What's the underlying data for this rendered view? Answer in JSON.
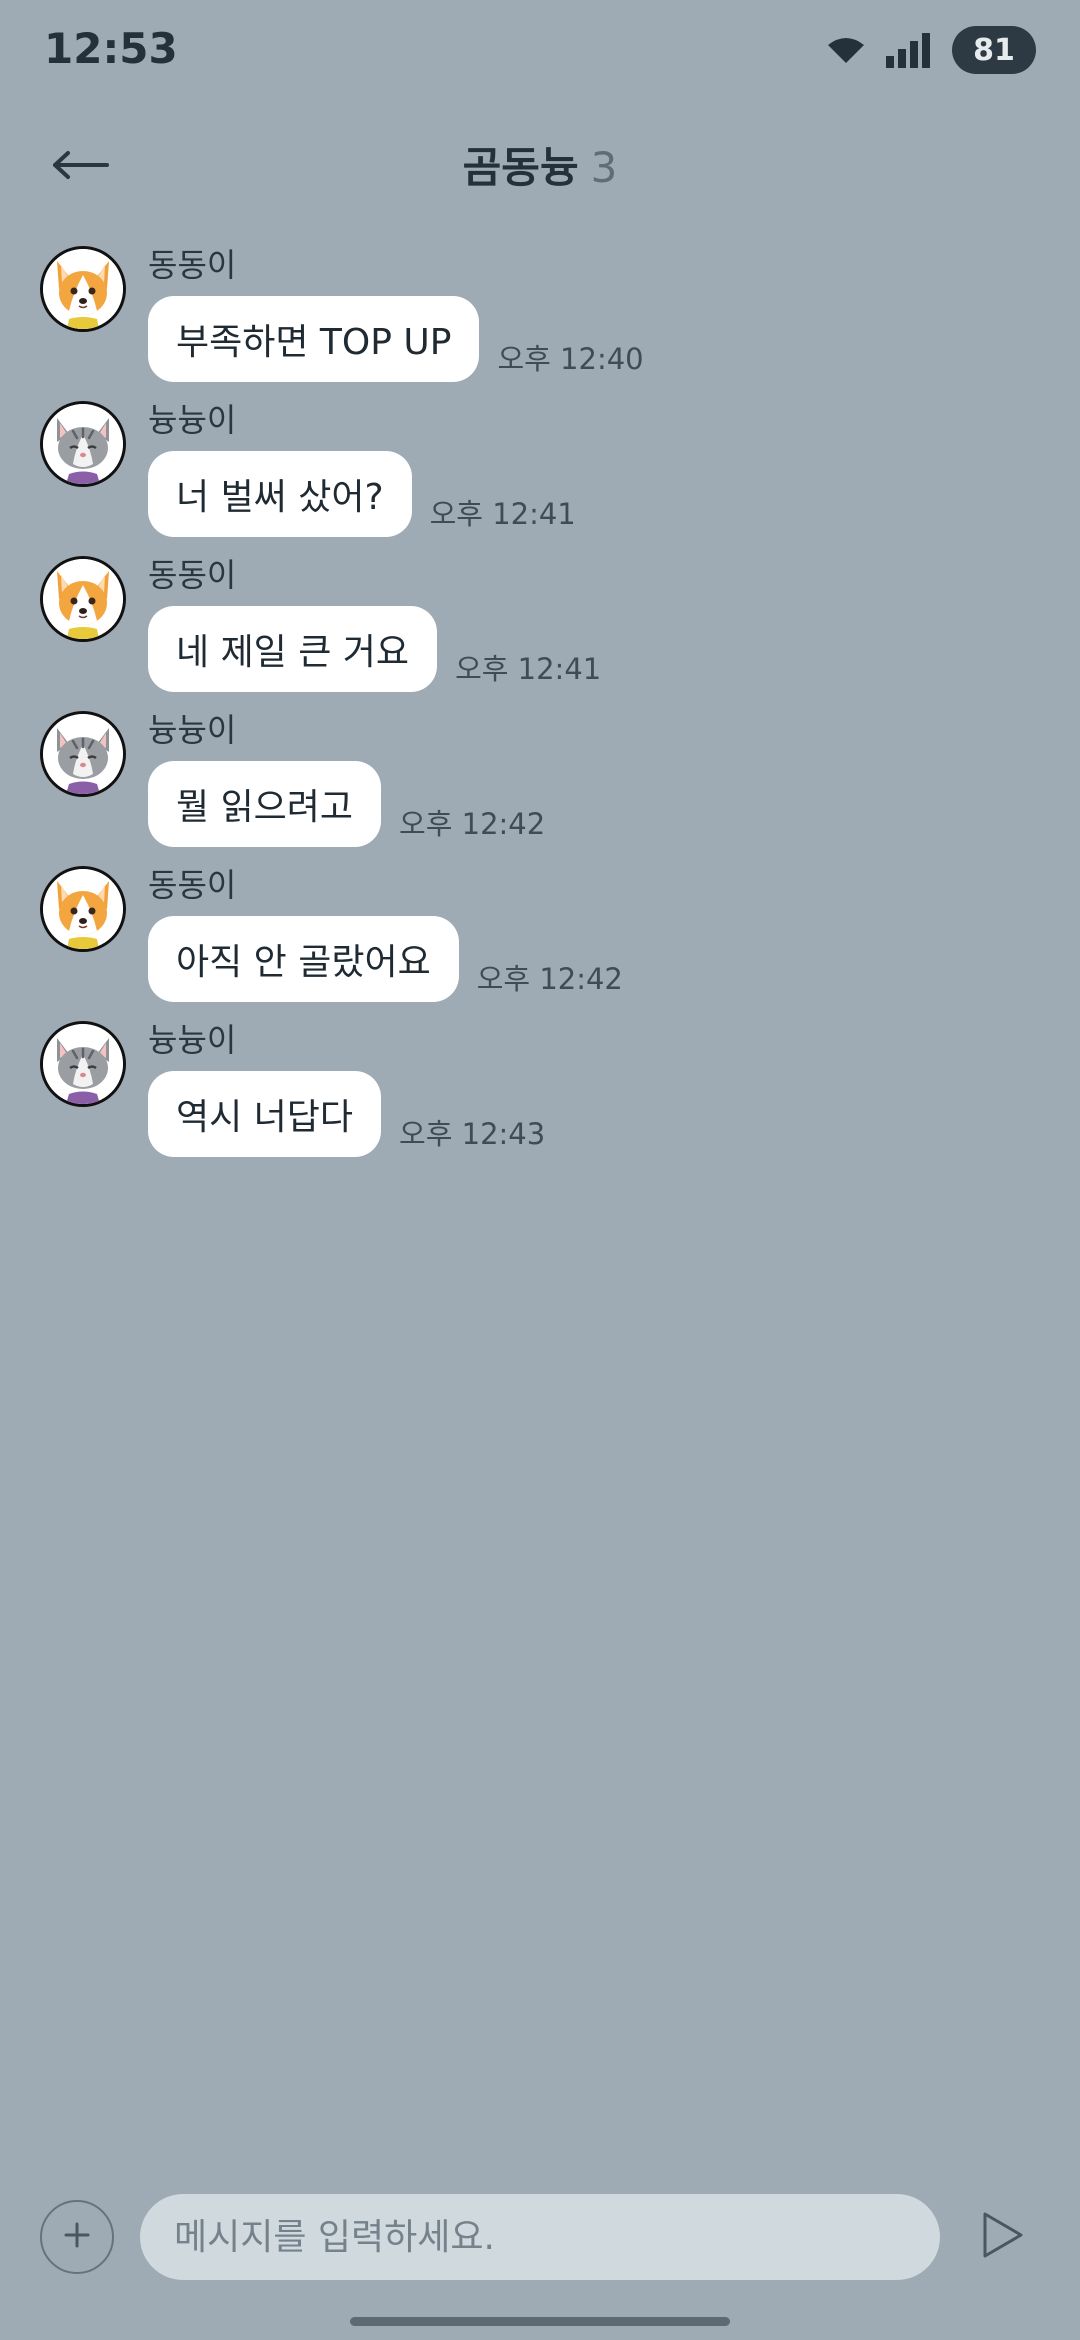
{
  "status_bar": {
    "time": "12:53",
    "battery": "81",
    "icons": [
      "wifi-icon",
      "signal-icon"
    ]
  },
  "header": {
    "title": "곰동늉",
    "member_count": "3",
    "back_icon": "arrow-left-icon"
  },
  "messages": [
    {
      "sender": "동동이",
      "avatar": "corgi-avatar",
      "text": "부족하면 TOP UP",
      "time": "오후 12:40"
    },
    {
      "sender": "늉늉이",
      "avatar": "cat-avatar",
      "text": "너 벌써 샀어?",
      "time": "오후 12:41"
    },
    {
      "sender": "동동이",
      "avatar": "corgi-avatar",
      "text": "네 제일 큰 거요",
      "time": "오후 12:41"
    },
    {
      "sender": "늉늉이",
      "avatar": "cat-avatar",
      "text": "뭘 읽으려고",
      "time": "오후 12:42"
    },
    {
      "sender": "동동이",
      "avatar": "corgi-avatar",
      "text": "아직 안 골랐어요",
      "time": "오후 12:42"
    },
    {
      "sender": "늉늉이",
      "avatar": "cat-avatar",
      "text": "역시 너답다",
      "time": "오후 12:43"
    }
  ],
  "composer": {
    "placeholder": "메시지를 입력하세요.",
    "attach_icon": "plus-icon",
    "send_icon": "send-icon"
  },
  "colors": {
    "background": "#9eabb4",
    "bubble": "#ffffff",
    "input": "#d0d9de",
    "battery_badge": "#2e3a43"
  }
}
